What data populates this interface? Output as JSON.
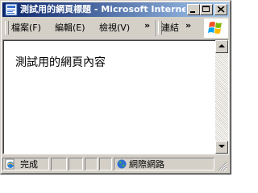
{
  "window": {
    "title": "測試用的網頁標題 - Microsoft Internet ..."
  },
  "menubar": {
    "items": [
      {
        "label": "檔案(F)"
      },
      {
        "label": "編輯(E)"
      },
      {
        "label": "檢視(V)"
      }
    ],
    "overflow_chevron": "»",
    "links_label": "連結",
    "links_chevron": "»"
  },
  "content": {
    "text": "測試用的網頁內容"
  },
  "statusbar": {
    "status_text": "完成",
    "zone_text": "網際網路"
  },
  "colors": {
    "titlebar_start": "#0a246a",
    "titlebar_end": "#a6caf0",
    "chrome": "#d4d0c8"
  }
}
